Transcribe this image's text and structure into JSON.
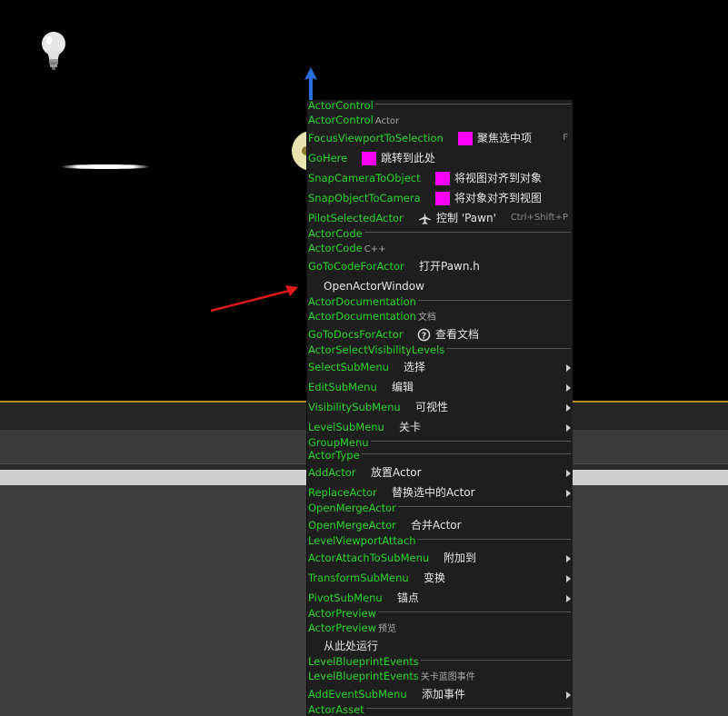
{
  "menu": {
    "sections": [
      {
        "header": "ActorControl",
        "sub": {
          "name": "ActorControl",
          "title": "Actor"
        },
        "items": [
          {
            "name": "FocusViewportToSelection",
            "swatch": true,
            "label": "聚焦选中项",
            "shortcut": "F"
          },
          {
            "name": "GoHere",
            "swatch": true,
            "label": "跳转到此处"
          },
          {
            "name": "SnapCameraToObject",
            "swatch": true,
            "label": "将视图对齐到对象"
          },
          {
            "name": "SnapObjectToCamera",
            "swatch": true,
            "label": "将对象对齐到视图"
          },
          {
            "name": "PilotSelectedActor",
            "icon": "airplane-icon",
            "label": "控制 'Pawn'",
            "shortcut": "Ctrl+Shift+P"
          }
        ]
      },
      {
        "header": "ActorCode",
        "sub": {
          "name": "ActorCode",
          "title": "C++"
        },
        "items": [
          {
            "name": "GoToCodeForActor",
            "label": "打开Pawn.h"
          },
          {
            "name": "",
            "label": "OpenActorWindow"
          }
        ]
      },
      {
        "header": "ActorDocumentation",
        "sub": {
          "name": "ActorDocumentation",
          "title": "文档"
        },
        "items": [
          {
            "name": "GoToDocsForActor",
            "icon": "help-icon",
            "label": "查看文档"
          }
        ]
      },
      {
        "header": "ActorSelectVisibilityLevels",
        "items": [
          {
            "name": "SelectSubMenu",
            "label": "选择",
            "submenu": true
          },
          {
            "name": "EditSubMenu",
            "label": "编辑",
            "submenu": true
          },
          {
            "name": "VisibilitySubMenu",
            "label": "可视性",
            "submenu": true
          },
          {
            "name": "LevelSubMenu",
            "label": "关卡",
            "submenu": true
          }
        ]
      },
      {
        "header": "GroupMenu",
        "items": []
      },
      {
        "header": "ActorType",
        "items": [
          {
            "name": "AddActor",
            "label": "放置Actor",
            "submenu": true
          },
          {
            "name": "ReplaceActor",
            "label": "替换选中的Actor",
            "submenu": true
          }
        ]
      },
      {
        "header": "OpenMergeActor",
        "items": [
          {
            "name": "OpenMergeActor",
            "label": "合并Actor"
          }
        ]
      },
      {
        "header": "LevelViewportAttach",
        "items": [
          {
            "name": "ActorAttachToSubMenu",
            "label": "附加到",
            "submenu": true
          },
          {
            "name": "TransformSubMenu",
            "label": "变换",
            "submenu": true
          },
          {
            "name": "PivotSubMenu",
            "label": "锚点",
            "submenu": true
          }
        ]
      },
      {
        "header": "ActorPreview",
        "sub": {
          "name": "ActorPreview",
          "title": "预览"
        },
        "items": [
          {
            "name": "",
            "label": "从此处运行"
          }
        ]
      },
      {
        "header": "LevelBlueprintEvents",
        "sub": {
          "name": "LevelBlueprintEvents",
          "title": "关卡蓝图事件"
        },
        "items": [
          {
            "name": "AddEventSubMenu",
            "label": "添加事件",
            "submenu": true
          }
        ]
      },
      {
        "header": "ActorAsset",
        "items": []
      }
    ]
  },
  "colors": {
    "menu_name_green": "#2ad42a",
    "swatch_magenta": "#ff00ff",
    "menu_bg": "#1e1e1e",
    "gold_line": "#b08d1e",
    "annotation_arrow": "#e01818",
    "transform_arrow": "#2a6fe0"
  }
}
